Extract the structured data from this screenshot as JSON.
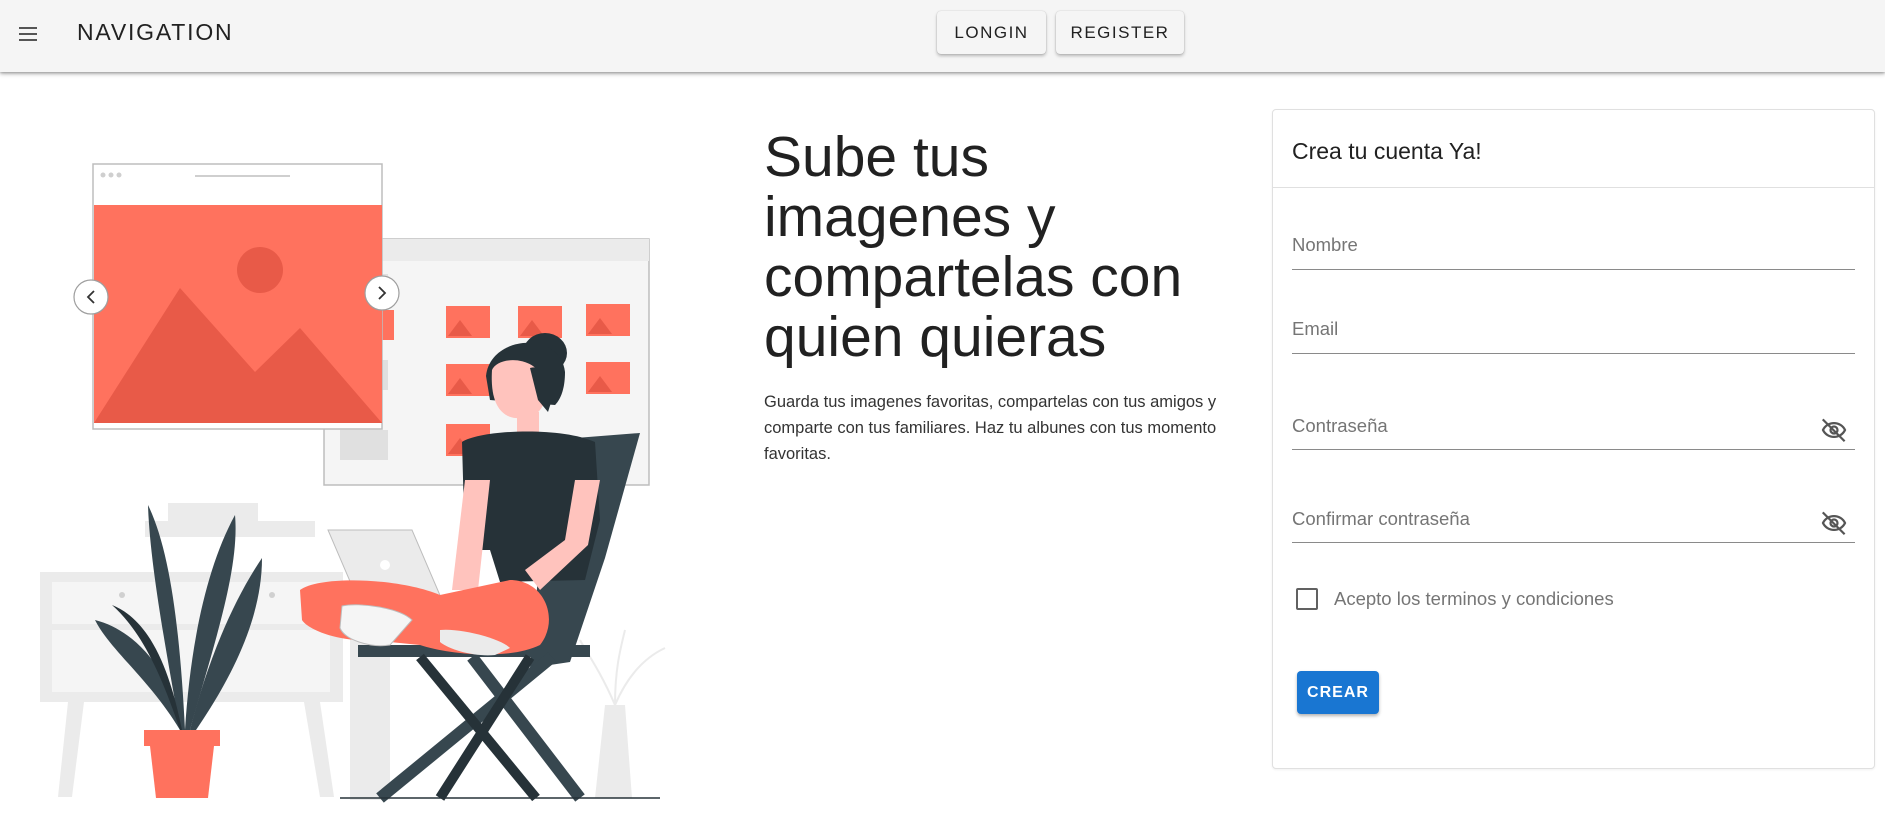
{
  "appbar": {
    "menu_icon": "hamburger-menu-icon",
    "title": "NAVIGATION",
    "login_label": "LONGIN",
    "register_label": "REGISTER"
  },
  "hero": {
    "title": "Sube tus imagenes y compartelas con quien quieras",
    "description": "Guarda tus imagenes favoritas, compartelas con tus amigos y comparte con tus familiares. Haz tu albunes con tus momento favoritas."
  },
  "illustration": {
    "prev_icon": "chevron-left-icon",
    "next_icon": "chevron-right-icon"
  },
  "signup_form": {
    "title": "Crea tu cuenta Ya!",
    "fields": [
      {
        "label": "Nombre",
        "value": ""
      },
      {
        "label": "Email",
        "value": ""
      },
      {
        "label": "Contraseña",
        "value": "",
        "icon": "eye-off-icon"
      },
      {
        "label": "Confirmar contraseña",
        "value": "",
        "icon": "eye-off-icon"
      }
    ],
    "terms_label": "Acepto los terminos y condiciones",
    "terms_checked": false,
    "submit_label": "CREAR"
  },
  "colors": {
    "appbar_bg": "#f5f5f5",
    "accent": "#1976d2",
    "illustration_coral": "#ff725e",
    "illustration_dark": "#263238",
    "illustration_teal": "#37474f"
  }
}
